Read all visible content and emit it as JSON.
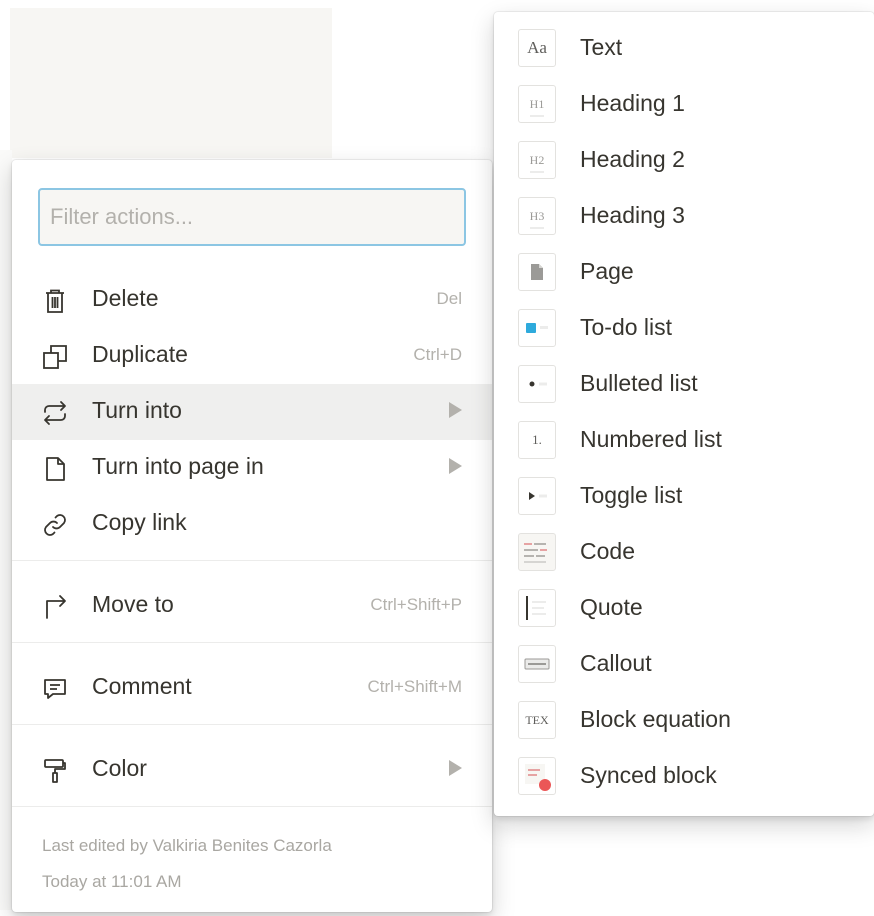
{
  "filter": {
    "placeholder": "Filter actions..."
  },
  "actions": [
    {
      "label": "Delete",
      "shortcut": "Del",
      "icon": "trash-icon"
    },
    {
      "label": "Duplicate",
      "shortcut": "Ctrl+D",
      "icon": "duplicate-icon"
    },
    {
      "label": "Turn into",
      "submenu": true,
      "icon": "turn-into-icon"
    },
    {
      "label": "Turn into page in",
      "submenu": true,
      "icon": "page-icon"
    },
    {
      "label": "Copy link",
      "icon": "link-icon"
    },
    {
      "label": "Move to",
      "shortcut": "Ctrl+Shift+P",
      "icon": "move-arrow-icon"
    },
    {
      "label": "Comment",
      "shortcut": "Ctrl+Shift+M",
      "icon": "comment-icon"
    },
    {
      "label": "Color",
      "submenu": true,
      "icon": "paint-roller-icon"
    }
  ],
  "footer": {
    "edited_by": "Last edited by Valkiria Benites Cazorla",
    "edited_at": "Today at 11:01 AM"
  },
  "turn_into_options": [
    {
      "label": "Text",
      "thumb": "Aa"
    },
    {
      "label": "Heading 1",
      "thumb": "H1"
    },
    {
      "label": "Heading 2",
      "thumb": "H2"
    },
    {
      "label": "Heading 3",
      "thumb": "H3"
    },
    {
      "label": "Page"
    },
    {
      "label": "To-do list"
    },
    {
      "label": "Bulleted list"
    },
    {
      "label": "Numbered list",
      "thumb": "1."
    },
    {
      "label": "Toggle list"
    },
    {
      "label": "Code"
    },
    {
      "label": "Quote"
    },
    {
      "label": "Callout"
    },
    {
      "label": "Block equation",
      "thumb": "TEX"
    },
    {
      "label": "Synced block"
    }
  ],
  "colors": {
    "accent_blue": "#2eaadc",
    "focus_ring": "#8cc6e3",
    "synced_dot": "#eb5757",
    "text": "#37352f",
    "muted": "#b3b1ac"
  }
}
